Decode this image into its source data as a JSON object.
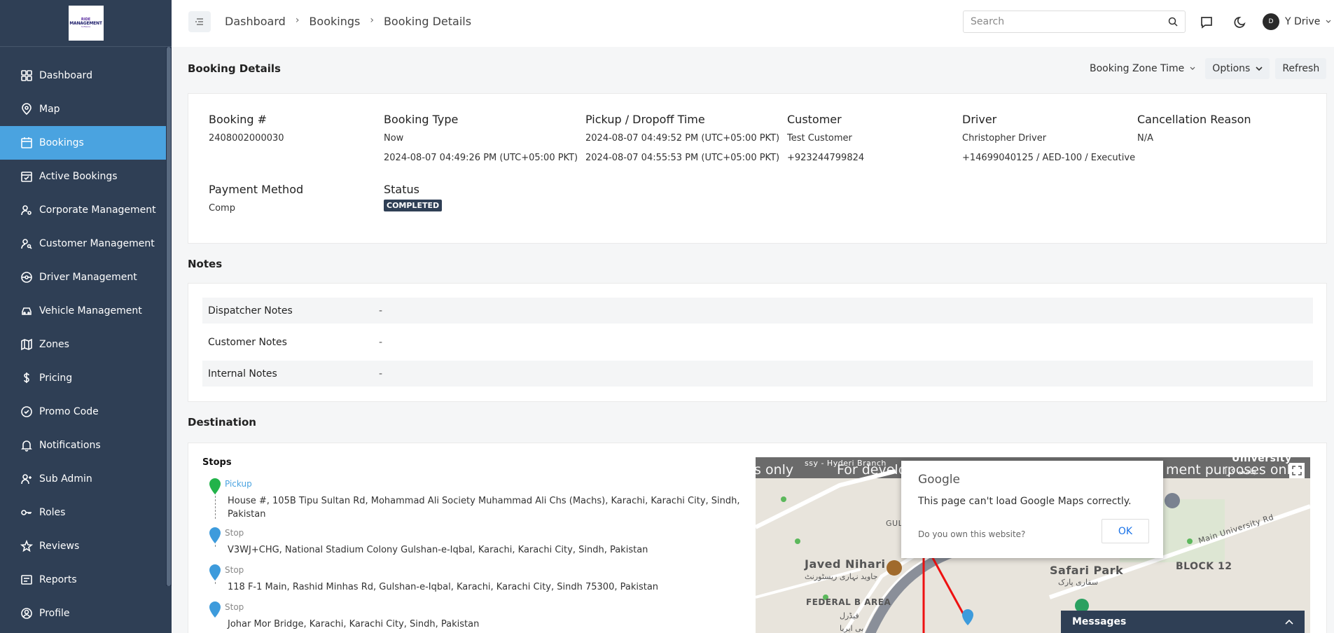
{
  "logo": {
    "line1": "RIDE",
    "line2": "MANAGEMENT",
    "line3": "Software"
  },
  "sidebar": {
    "items": [
      {
        "label": "Dashboard",
        "icon": "grid-icon"
      },
      {
        "label": "Map",
        "icon": "map-pin-icon"
      },
      {
        "label": "Bookings",
        "icon": "calendar-icon",
        "active": true
      },
      {
        "label": "Active Bookings",
        "icon": "calendar-check-icon"
      },
      {
        "label": "Corporate Management",
        "icon": "user-gear-icon"
      },
      {
        "label": "Customer Management",
        "icon": "user-search-icon"
      },
      {
        "label": "Driver Management",
        "icon": "steering-wheel-icon"
      },
      {
        "label": "Vehicle Management",
        "icon": "car-icon"
      },
      {
        "label": "Zones",
        "icon": "map-icon"
      },
      {
        "label": "Pricing",
        "icon": "dollar-icon"
      },
      {
        "label": "Promo Code",
        "icon": "badge-check-icon"
      },
      {
        "label": "Notifications",
        "icon": "bell-icon"
      },
      {
        "label": "Sub Admin",
        "icon": "user-plus-icon"
      },
      {
        "label": "Roles",
        "icon": "key-icon"
      },
      {
        "label": "Reviews",
        "icon": "star-icon"
      },
      {
        "label": "Reports",
        "icon": "report-icon"
      },
      {
        "label": "Profile",
        "icon": "user-circle-icon"
      }
    ]
  },
  "topbar": {
    "breadcrumb": [
      "Dashboard",
      "Bookings",
      "Booking Details"
    ],
    "search_placeholder": "Search",
    "user_name": "Y Drive",
    "avatar_text": "D"
  },
  "page": {
    "title": "Booking Details",
    "zone_time_label": "Booking Zone Time",
    "options_label": "Options",
    "refresh_label": "Refresh"
  },
  "booking": {
    "number_label": "Booking #",
    "number": "2408002000030",
    "type_label": "Booking Type",
    "type": "Now",
    "type_time": "2024-08-07 04:49:26 PM (UTC+05:00 PKT)",
    "time_label": "Pickup / Dropoff Time",
    "pickup_time": "2024-08-07 04:49:52 PM (UTC+05:00 PKT)",
    "dropoff_time": "2024-08-07 04:55:53 PM (UTC+05:00 PKT)",
    "customer_label": "Customer",
    "customer_name": "Test Customer",
    "customer_phone": "+923244799824",
    "driver_label": "Driver",
    "driver_name": "Christopher Driver",
    "driver_info": "+14699040125 / AED-100 / Executive",
    "cancel_label": "Cancellation Reason",
    "cancel_reason": "N/A",
    "payment_label": "Payment Method",
    "payment": "Comp",
    "status_label": "Status",
    "status": "COMPLETED"
  },
  "notes": {
    "title": "Notes",
    "rows": [
      {
        "label": "Dispatcher Notes",
        "value": "-"
      },
      {
        "label": "Customer Notes",
        "value": "-"
      },
      {
        "label": "Internal Notes",
        "value": "-"
      }
    ]
  },
  "destination": {
    "title": "Destination",
    "stops_title": "Stops",
    "stops": [
      {
        "kind": "Pickup",
        "address": "House #, 105B Tipu Sultan Rd, Mohammad Ali Society Muhammad Ali Chs (Machs), Karachi, Karachi City, Sindh, Pakistan",
        "color": "#22b34a"
      },
      {
        "kind": "Stop",
        "address": "V3WJ+CHG, National Stadium Colony Gulshan-e-Iqbal, Karachi, Karachi City, Sindh, Pakistan",
        "color": "#3d9bdc"
      },
      {
        "kind": "Stop",
        "address": "118 F-1 Main, Rashid Minhas Rd, Gulshan-e-Iqbal, Karachi, Karachi City, Sindh 75300, Pakistan",
        "color": "#3d9bdc"
      },
      {
        "kind": "Stop",
        "address": "Johar Mor Bridge, Karachi, Karachi City, Sindh, Pakistan",
        "color": "#3d9bdc"
      }
    ]
  },
  "map": {
    "dev_text_1": "s only",
    "dev_text_2": "For develo",
    "dev_text_3": "ment purposes only",
    "dialog_brand": "Google",
    "dialog_message": "This page can't load Google Maps correctly.",
    "dialog_own": "Do you own this website?",
    "dialog_ok": "OK",
    "labels": {
      "hyderi": "ssy - Hyderi Branch",
      "gulberg": "GULBER",
      "javed": "Javed Nihari",
      "javed_urdu": "جاوید نہاری ریسٹورنٹ",
      "safari": "Safari Park",
      "safari_urdu": "سفاری پارک",
      "block12": "BLOCK 12",
      "university_rd": "Main University Rd",
      "federal": "FEDERAL B AREA",
      "federal_urdu": "فیڈرل",
      "bi_area": "بی ایریا",
      "university": "University",
      "university_urdu": "جامعہ کرا"
    }
  },
  "messages": {
    "label": "Messages"
  },
  "colors": {
    "sidebar": "#2f3f55",
    "active": "#4aa3e0",
    "badge": "#2f3f55"
  }
}
